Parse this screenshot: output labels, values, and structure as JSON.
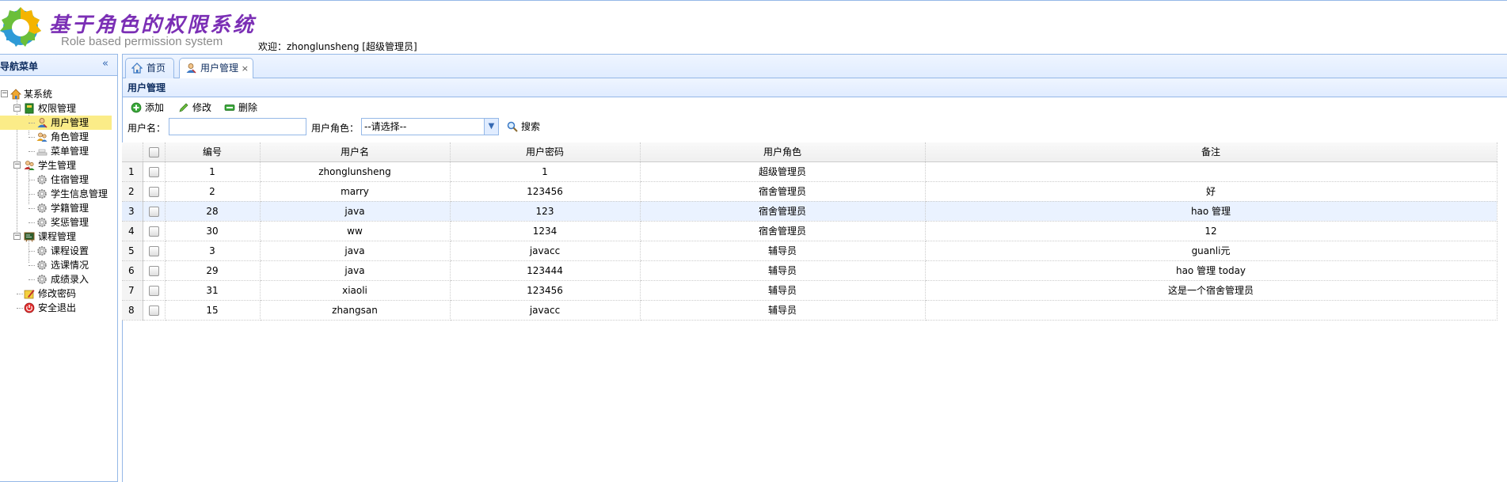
{
  "header": {
    "title_cn": "基于角色的权限系统",
    "title_en": "Role based permission system",
    "welcome": "欢迎：zhonglunsheng [超级管理员]"
  },
  "nav": {
    "title": "导航菜单",
    "tree": {
      "root": "某系统",
      "groups": [
        {
          "label": "权限管理",
          "items": [
            "用户管理",
            "角色管理",
            "菜单管理"
          ]
        },
        {
          "label": "学生管理",
          "items": [
            "住宿管理",
            "学生信息管理",
            "学籍管理",
            "奖惩管理"
          ]
        },
        {
          "label": "课程管理",
          "items": [
            "课程设置",
            "选课情况",
            "成绩录入"
          ]
        }
      ],
      "extra": [
        "修改密码",
        "安全退出"
      ],
      "selected": "用户管理"
    }
  },
  "tabs": [
    {
      "label": "首页",
      "icon": "home-icon"
    },
    {
      "label": "用户管理",
      "icon": "user-icon",
      "closable": true,
      "active": true
    }
  ],
  "panel": {
    "title": "用户管理",
    "toolbar": {
      "add": "添加",
      "edit": "修改",
      "delete": "删除"
    },
    "search": {
      "username_label": "用户名：",
      "username_value": "",
      "role_label": "用户角色：",
      "role_selected": "--请选择--",
      "search_button": "搜索"
    }
  },
  "grid": {
    "columns": [
      "编号",
      "用户名",
      "用户密码",
      "用户角色",
      "备注"
    ],
    "rows": [
      {
        "rn": "1",
        "id": "1",
        "name": "zhonglunsheng",
        "password": "1",
        "role": "超级管理员",
        "note": ""
      },
      {
        "rn": "2",
        "id": "2",
        "name": "marry",
        "password": "123456",
        "role": "宿舍管理员",
        "note": "好"
      },
      {
        "rn": "3",
        "id": "28",
        "name": "java",
        "password": "123",
        "role": "宿舍管理员",
        "note": "hao 管理"
      },
      {
        "rn": "4",
        "id": "30",
        "name": "ww",
        "password": "1234",
        "role": "宿舍管理员",
        "note": "12"
      },
      {
        "rn": "5",
        "id": "3",
        "name": "java",
        "password": "javacc",
        "role": "辅导员",
        "note": "guanli元"
      },
      {
        "rn": "6",
        "id": "29",
        "name": "java",
        "password": "123444",
        "role": "辅导员",
        "note": "hao 管理 today"
      },
      {
        "rn": "7",
        "id": "31",
        "name": "xiaoli",
        "password": "123456",
        "role": "辅导员",
        "note": "这是一个宿舍管理员"
      },
      {
        "rn": "8",
        "id": "15",
        "name": "zhangsan",
        "password": "javacc",
        "role": "辅导员",
        "note": ""
      }
    ],
    "highlighted_row": 3
  },
  "colors": {
    "border": "#95b8e7",
    "header_bg": "#e0ecff",
    "selected_node": "#fbec88",
    "title_purple": "#7b2fb5"
  }
}
